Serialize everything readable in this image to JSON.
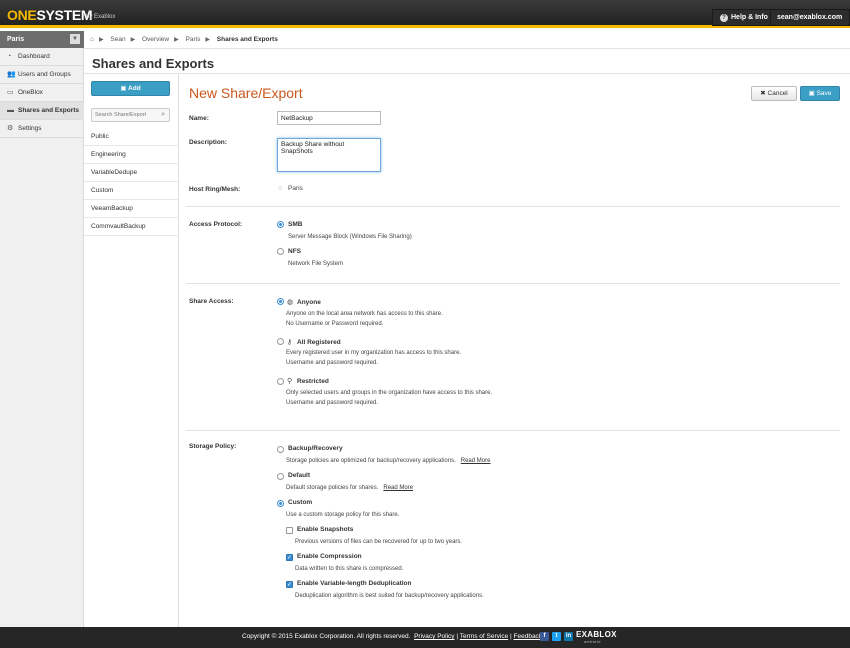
{
  "header": {
    "logo_one": "ONE",
    "logo_system": "SYSTEM",
    "logo_by": "by Exablox",
    "help_label": "Help & Info",
    "user_label": "sean@exablox.com"
  },
  "sidebar": {
    "location": "Paris",
    "items": [
      {
        "label": "Dashboard",
        "icon": "dashboard-icon"
      },
      {
        "label": "Users and Groups",
        "icon": "users-icon"
      },
      {
        "label": "OneBlox",
        "icon": "oneblox-icon"
      },
      {
        "label": "Shares and Exports",
        "icon": "folder-icon"
      },
      {
        "label": "Settings",
        "icon": "gear-icon"
      }
    ]
  },
  "breadcrumb": {
    "items": [
      "Sean",
      "Overview",
      "Paris",
      "Shares and Exports"
    ]
  },
  "page_title": "Shares and Exports",
  "list": {
    "add_label": "Add",
    "search_placeholder": "Search Share/Export",
    "shares": [
      "Public",
      "Engineering",
      "VariableDedupe",
      "Custom",
      "VeeamBackup",
      "CommvaultBackup"
    ]
  },
  "form": {
    "title": "New Share/Export",
    "cancel_label": "Cancel",
    "save_label": "Save",
    "name_label": "Name:",
    "name_value": "NetBackup",
    "description_label": "Description:",
    "description_value": "Backup Share without SnapShots",
    "host_label": "Host Ring/Mesh:",
    "host_value": "Paris",
    "access_protocol_label": "Access Protocol:",
    "protocols": [
      {
        "title": "SMB",
        "desc": "Server Message Block (Windows File Sharing)",
        "selected": true
      },
      {
        "title": "NFS",
        "desc": "Network File System",
        "selected": false
      }
    ],
    "share_access_label": "Share Access:",
    "access": [
      {
        "title": "Anyone",
        "desc1": "Anyone on the local area network has access to this share.",
        "desc2": "No Username or Password required.",
        "selected": true,
        "icon": "globe-icon"
      },
      {
        "title": "All Registered",
        "desc1": "Every registered user in my organization has access to this share.",
        "desc2": "Username and password required.",
        "selected": false,
        "icon": "key-icon"
      },
      {
        "title": "Restricted",
        "desc1": "Only selected users and groups in the organization have access to this share.",
        "desc2": "Username and password required.",
        "selected": false,
        "icon": "restricted-user-icon"
      }
    ],
    "storage_policy_label": "Storage Policy:",
    "policies": [
      {
        "title": "Backup/Recovery",
        "desc": "Storage policies are optimized for backup/recovery applications.",
        "link": "Read More",
        "selected": false
      },
      {
        "title": "Default",
        "desc": "Default storage policies for shares.",
        "link": "Read More",
        "selected": false
      },
      {
        "title": "Custom",
        "desc": "Use a custom storage policy for this share.",
        "link": "",
        "selected": true
      }
    ],
    "custom_options": [
      {
        "title": "Enable Snapshots",
        "desc": "Previous versions of files can be recovered for up to two years.",
        "checked": false
      },
      {
        "title": "Enable Compression",
        "desc": "Data written to this share is compressed.",
        "checked": true
      },
      {
        "title": "Enable Variable-length Deduplication",
        "desc": "Deduplication algorithm is best suited for backup/recovery applications.",
        "checked": true
      }
    ]
  },
  "footer": {
    "copyright": "Copyright © 2015 Exablox Corporation. All rights reserved.",
    "privacy": "Privacy Policy",
    "terms": "Terms of Service",
    "feedback": "Feedback",
    "sep": "|",
    "logo": "EXABLOX",
    "logo_sub": "website",
    "social_colors": [
      "#3b5998",
      "#1da1f2",
      "#0e76a8"
    ]
  }
}
